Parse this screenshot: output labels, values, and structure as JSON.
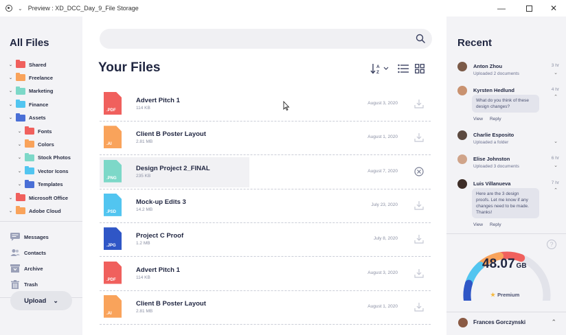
{
  "window": {
    "title": "Preview : XD_DCC_Day_9_File Storage",
    "controls": [
      "minimize",
      "maximize",
      "close"
    ]
  },
  "sidebar": {
    "heading": "All Files",
    "folders": [
      {
        "label": "Shared",
        "color": "#f0605d",
        "indent": 0
      },
      {
        "label": "Freelance",
        "color": "#f9a35b",
        "indent": 0
      },
      {
        "label": "Marketing",
        "color": "#7dd8c8",
        "indent": 0
      },
      {
        "label": "Finance",
        "color": "#52c5f0",
        "indent": 0
      },
      {
        "label": "Assets",
        "color": "#4a6fd6",
        "indent": 0
      },
      {
        "label": "Fonts",
        "color": "#f0605d",
        "indent": 1
      },
      {
        "label": "Colors",
        "color": "#f9a35b",
        "indent": 1
      },
      {
        "label": "Stock Photos",
        "color": "#7dd8c8",
        "indent": 1
      },
      {
        "label": "Vector Icons",
        "color": "#52c5f0",
        "indent": 1
      },
      {
        "label": "Templates",
        "color": "#4a6fd6",
        "indent": 1
      },
      {
        "label": "Microsoft Office",
        "color": "#f0605d",
        "indent": 0
      },
      {
        "label": "Adobe Cloud",
        "color": "#f9a35b",
        "indent": 0
      }
    ],
    "nav": [
      {
        "label": "Messages",
        "icon": "chat-icon"
      },
      {
        "label": "Contacts",
        "icon": "contacts-icon"
      },
      {
        "label": "Archive",
        "icon": "archive-icon"
      },
      {
        "label": "Trash",
        "icon": "trash-icon"
      }
    ],
    "upload_label": "Upload"
  },
  "main": {
    "search_placeholder": "",
    "title": "Your Files",
    "files": [
      {
        "name": "Advert Pitch 1",
        "size": "114 KB",
        "date": "August 3, 2020",
        "ext": ".PDF",
        "color": "#f0605d",
        "action": "download"
      },
      {
        "name": "Client B Poster Layout",
        "size": "2.81 MB",
        "date": "August 1, 2020",
        "ext": ".AI",
        "color": "#f9a35b",
        "action": "download"
      },
      {
        "name": "Design Project 2_FINAL",
        "size": "235 KB",
        "date": "August 7, 2020",
        "ext": ".PNG",
        "color": "#7dd8c8",
        "action": "cancel"
      },
      {
        "name": "Mock-up Edits 3",
        "size": "14.2 MB",
        "date": "July 23, 2020",
        "ext": ".PSD",
        "color": "#52c5f0",
        "action": "download"
      },
      {
        "name": "Project C Proof",
        "size": "1.2 MB",
        "date": "July 8, 2020",
        "ext": ".JPG",
        "color": "#2f56c6",
        "action": "download"
      },
      {
        "name": "Advert Pitch 1",
        "size": "114 KB",
        "date": "August 3, 2020",
        "ext": ".PDF",
        "color": "#f0605d",
        "action": "download"
      },
      {
        "name": "Client B Poster Layout",
        "size": "2.81 MB",
        "date": "August 1, 2020",
        "ext": ".AI",
        "color": "#f9a35b",
        "action": "download"
      }
    ]
  },
  "recent": {
    "heading": "Recent",
    "items": [
      {
        "name": "Anton Zhou",
        "sub": "Uploaded 2 documents",
        "time": "3 hr",
        "avatar_color": "#7b5a48",
        "chevron": "down"
      },
      {
        "name": "Kyrsten Hedlund",
        "sub": "",
        "time": "4 hr",
        "avatar_color": "#c99270",
        "chevron": "up",
        "message": [
          "What do you think of these",
          "design changes?"
        ],
        "actions": [
          "View",
          "Reply"
        ]
      },
      {
        "name": "Charlie Esposito",
        "sub": "Uploaded a folder",
        "time": "",
        "avatar_color": "#5c4a40",
        "chevron": "down"
      },
      {
        "name": "Elise Johnston",
        "sub": "Uploaded 3 documents",
        "time": "6 hr",
        "avatar_color": "#d0a48a",
        "chevron": "down"
      },
      {
        "name": "Luis Villanueva",
        "sub": "",
        "time": "7 hr",
        "avatar_color": "#3e2e28",
        "chevron": "up",
        "message": [
          "Here are the 3 design",
          "proofs. Let me know if any",
          "changes need to be made.",
          "Thanks!"
        ],
        "actions": [
          "View",
          "Reply"
        ]
      }
    ]
  },
  "storage": {
    "value": "48.07",
    "unit": "GB",
    "plan": "Premium",
    "fraction_used": 0.6,
    "colors": [
      "#2f56c6",
      "#52c5f0",
      "#f9a35b",
      "#f0605d"
    ]
  },
  "user": {
    "name": "Frances Gorczynski",
    "avatar_color": "#8a5a44"
  }
}
